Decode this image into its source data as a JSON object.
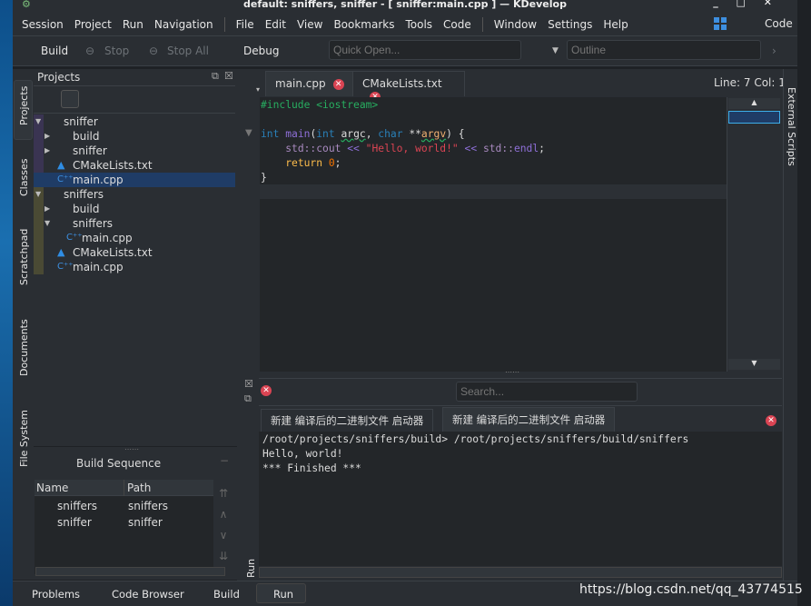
{
  "window": {
    "title": "default: sniffers, sniffer - [ sniffer:main.cpp ] — KDevelop",
    "controls": [
      "_",
      "□",
      "✕"
    ]
  },
  "menubar": {
    "items": [
      "Session",
      "Project",
      "Run",
      "Navigation",
      "File",
      "Edit",
      "View",
      "Bookmarks",
      "Tools",
      "Code",
      "Window",
      "Settings",
      "Help"
    ],
    "area": "Code"
  },
  "toolbar": {
    "build": "Build",
    "stop": "Stop",
    "stop_all": "Stop All",
    "debug": "Debug",
    "quick_open_placeholder": "Quick Open...",
    "outline_placeholder": "Outline"
  },
  "left_tabs": [
    "Projects",
    "Classes",
    "Scratchpad",
    "Documents",
    "File System"
  ],
  "projects": {
    "title": "Projects",
    "tree": [
      {
        "label": "sniffer",
        "icon": "folder",
        "expanded": true,
        "level": 0
      },
      {
        "label": "build",
        "icon": "folder",
        "expanded": false,
        "level": 1
      },
      {
        "label": "sniffer",
        "icon": "folder",
        "expanded": false,
        "level": 1
      },
      {
        "label": "CMakeLists.txt",
        "icon": "cmake",
        "level": 1
      },
      {
        "label": "main.cpp",
        "icon": "cpp",
        "level": 1,
        "selected": true
      },
      {
        "label": "sniffers",
        "icon": "folder",
        "expanded": true,
        "level": 0
      },
      {
        "label": "build",
        "icon": "folder",
        "expanded": false,
        "level": 1
      },
      {
        "label": "sniffers",
        "icon": "folder",
        "expanded": true,
        "level": 1
      },
      {
        "label": "main.cpp",
        "icon": "cpp",
        "level": 2
      },
      {
        "label": "CMakeLists.txt",
        "icon": "cmake",
        "level": 1
      },
      {
        "label": "main.cpp",
        "icon": "cpp",
        "level": 1
      }
    ]
  },
  "build_sequence": {
    "title": "Build Sequence",
    "columns": [
      "Name",
      "Path"
    ],
    "rows": [
      [
        "sniffers",
        "sniffers"
      ],
      [
        "sniffer",
        "sniffer"
      ]
    ]
  },
  "editor": {
    "tabs": [
      "main.cpp",
      "CMakeLists.txt"
    ],
    "active_tab": 0,
    "cursor": "Line: 7 Col: 1",
    "code": [
      "#include <iostream>",
      "",
      "int main(int argc, char **argv) {",
      "    std::cout << \"Hello, world!\" << std::endl;",
      "    return 0;",
      "}",
      ""
    ]
  },
  "right_tabs": [
    "External Scripts"
  ],
  "output": {
    "search_placeholder": "Search...",
    "tabs": [
      "新建 编译后的二进制文件 启动器",
      "新建 编译后的二进制文件 启动器"
    ],
    "active_tab": 1,
    "lines": [
      "/root/projects/sniffers/build> /root/projects/sniffers/build/sniffers",
      "Hello, world!",
      "*** Finished ***"
    ],
    "side_label": "Run"
  },
  "bottom_tabs": [
    "Problems",
    "Code Browser",
    "Build",
    "Run"
  ],
  "watermark": "https://blog.csdn.net/qq_43774515",
  "colors": {
    "accent": "#3daee9",
    "selection": "#1f3c66",
    "close": "#da4453",
    "keyword": "#2980b9",
    "function": "#8e44ad",
    "string": "#da4453",
    "number": "#f67400",
    "preproc": "#27ae60"
  }
}
